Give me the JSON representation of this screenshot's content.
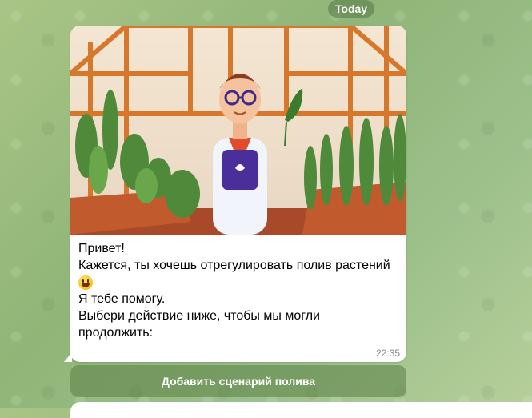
{
  "chat": {
    "date_label": "Today",
    "message": {
      "lines": [
        "Привет!",
        "Кажется, ты хочешь отрегулировать полив растений",
        "Я тебе помогу.",
        "",
        "Выбери действие ниже, чтобы мы могли",
        "продолжить:"
      ],
      "emoji": "grinning-face-emoji",
      "time": "22:35"
    },
    "action_button_label": "Добавить сценарий полива"
  },
  "colors": {
    "background": "#9cc08a",
    "bubble": "#ffffff",
    "pill": "#547846"
  }
}
